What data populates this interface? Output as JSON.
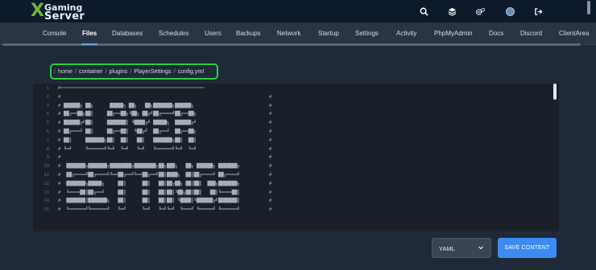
{
  "brand": {
    "logo_mark": "X",
    "logo_line1": "Gaming",
    "logo_line2": "Server"
  },
  "top_icons": [
    "search-icon",
    "layers-icon",
    "cogs-icon",
    "avatar",
    "logout-icon"
  ],
  "tabs": [
    {
      "label": "Console"
    },
    {
      "label": "Files",
      "active": true
    },
    {
      "label": "Databases"
    },
    {
      "label": "Schedules"
    },
    {
      "label": "Users"
    },
    {
      "label": "Backups"
    },
    {
      "label": "Network"
    },
    {
      "label": "Startup"
    },
    {
      "label": "Settings"
    },
    {
      "label": "Activity"
    },
    {
      "label": "PhpMyAdmin"
    },
    {
      "label": "Docs"
    },
    {
      "label": "Discord"
    },
    {
      "label": "ClientArea"
    }
  ],
  "breadcrumb": {
    "leading_sep": "/",
    "items": [
      "home",
      "container",
      "plugins",
      "PlayerSettings",
      "config.yml"
    ],
    "sep": "/"
  },
  "editor": {
    "line_numbers": [
      "1",
      "2",
      "3",
      "4",
      "5",
      "6",
      "7",
      "8",
      "9",
      "10",
      "11",
      "12",
      "13",
      "14",
      "15"
    ],
    "border_line": "#=====================================================",
    "hash": "#",
    "art_lines": [
      "██████╗ ██╗      █████╗ ██╗   ██╗███████╗██████╗",
      "██╔══██╗██║     ██╔══██╗╚██╗ ██╔╝██╔════╝██╔══██╗",
      "██████╔╝██║     ███████║ ╚████╔╝ █████╗  ██████╔╝",
      "██╔═══╝ ██║     ██╔══██║  ╚██╔╝  ██╔══╝  ██╔══██╗",
      "██║     ███████╗██║  ██║   ██║   ███████╗██║  ██║",
      "╚═╝     ╚══════╝╚═╝  ╚═╝   ╚═╝   ╚══════╝╚═╝  ╚═╝",
      "",
      " ███████╗███████╗████████╗████████╗██╗███╗   ██╗ ██████╗ ███████╗",
      " ██╔════╝██╔════╝╚══██╔══╝╚══██╔══╝██║████╗  ██║██╔════╝ ██╔════╝",
      " ███████╗█████╗     ██║      ██║   ██║██╔██╗ ██║██║  ███╗███████╗",
      " ╚════██║██╔══╝     ██║      ██║   ██║██║╚██╗██║██║   ██║╚════██║",
      " ███████║███████╗   ██║      ██║   ██║██║ ╚████║╚██████╔╝███████║",
      " ╚══════╝╚══════╝   ╚═╝      ╚═╝   ╚═╝╚═╝  ╚═══╝ ╚═════╝ ╚══════╝"
    ]
  },
  "language_select": {
    "value": "YAML"
  },
  "save_button": {
    "label": "SAVE CONTENT"
  },
  "colors": {
    "accent": "#3d8bf2",
    "highlight_box": "#2ecc40",
    "brand_green": "#6db33f"
  }
}
